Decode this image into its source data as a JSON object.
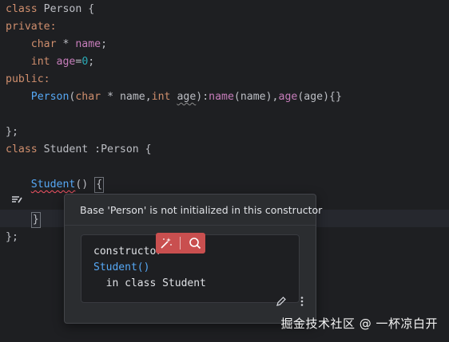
{
  "code": {
    "l1_kw": "class",
    "l1_name": " Person {",
    "l2": "private:",
    "l3_type": "char",
    "l3_op": " * ",
    "l3_field": "name",
    "l3_end": ";",
    "l4_type": "int",
    "l4_field": " age",
    "l4_eq": "=",
    "l4_num": "0",
    "l4_end": ";",
    "l5": "public:",
    "l6_fn": "Person",
    "l6_open": "(",
    "l6_t1": "char",
    "l6_mid1": " * name,",
    "l6_t2": "int",
    "l6_sp": " ",
    "l6_age": "age",
    "l6_close": "):",
    "l6_f1": "name",
    "l6_arg1": "(name),",
    "l6_f2": "age",
    "l6_arg2": "(age){}",
    "l8": "};",
    "l9_kw": "class",
    "l9_rest": " Student :Person {",
    "l11_fn": "Student",
    "l11_parens": "()",
    "l11_sp": " ",
    "l11_brace": "{",
    "l13_brace": "}",
    "l14": "};"
  },
  "popup": {
    "message": "Base 'Person' is not initialized in this constructor",
    "doc_kind": "constructor",
    "doc_name": "Student()",
    "doc_class": "  in class Student"
  },
  "icons": {
    "gutter": "intention-icon",
    "ai_fix": "ai-wand-icon",
    "ai_search": "search-icon",
    "edit": "pencil-icon",
    "more": "more-vertical-icon"
  },
  "watermark": "掘金技术社区 @ 一杯凉白开",
  "colors": {
    "background": "#1e1f22",
    "keyword": "#cf8e6d",
    "field": "#c77dbb",
    "number": "#2aacb8",
    "function": "#56a8f5",
    "error_underline": "#f75464",
    "ai_badge": "#c94f4f"
  }
}
